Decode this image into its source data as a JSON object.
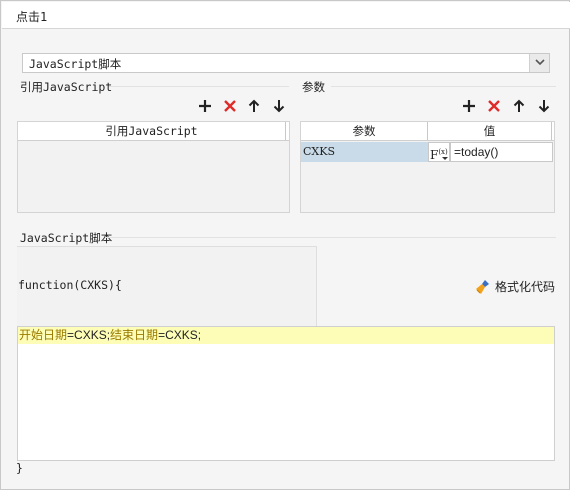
{
  "dialog": {
    "title": "点击1"
  },
  "script_type": {
    "selected": "JavaScript脚本"
  },
  "referenced_js": {
    "section_label": "引用JavaScript",
    "column_header": "引用JavaScript"
  },
  "params": {
    "section_label": "参数",
    "columns": {
      "name": "参数",
      "value": "值"
    },
    "rows": [
      {
        "name": "CXKS",
        "fx": "F",
        "fx_sub": "(x)",
        "value": "=today()"
      }
    ]
  },
  "toolbar_icons": [
    "add-icon",
    "delete-icon",
    "move-up-icon",
    "move-down-icon"
  ],
  "script": {
    "section_label": "JavaScript脚本",
    "function_header": "function(CXKS){",
    "line1_part1": "开始日期",
    "line1_part2": "=CXKS;",
    "line1_part3": "结束日期",
    "line1_part4": "=CXKS;",
    "closing": "}",
    "format_button": "格式化代码"
  },
  "colors": {
    "delete": "#e02b2b",
    "selected_row": "#c9dbe8",
    "highlight_line": "#fdfdb7"
  }
}
